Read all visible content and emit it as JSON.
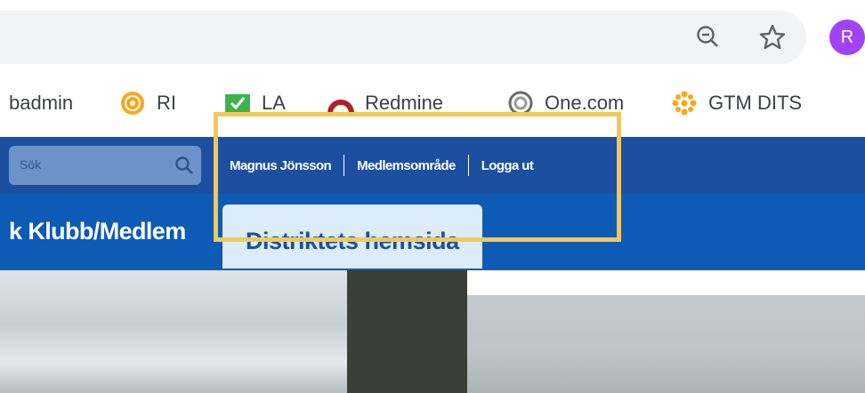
{
  "browser": {
    "icons": {
      "zoom": "zoom-out-icon",
      "bookmark": "star-icon"
    },
    "profile_initial": "R",
    "bookmarks": [
      {
        "label": "badmin",
        "icon": "none"
      },
      {
        "label": "RI",
        "icon": "rotary-wheel-icon"
      },
      {
        "label": "LA",
        "icon": "green-check-icon"
      },
      {
        "label": "Redmine",
        "icon": "redmine-icon"
      },
      {
        "label": "One.com",
        "icon": "onecom-icon"
      },
      {
        "label": "GTM DITS",
        "icon": "gtm-icon"
      }
    ]
  },
  "site": {
    "search": {
      "placeholder": "Sök"
    },
    "user_links": [
      "Magnus Jönsson",
      "Medlemsområde",
      "Logga ut"
    ],
    "nav": {
      "left_label": "k Klubb/Medlem",
      "button_label": "Distriktets hemsida"
    }
  },
  "colors": {
    "header_top": "#1c4fa0",
    "header_nav": "#0d5bb5",
    "highlight": "#f3c85a",
    "avatar": "#a142f4"
  }
}
